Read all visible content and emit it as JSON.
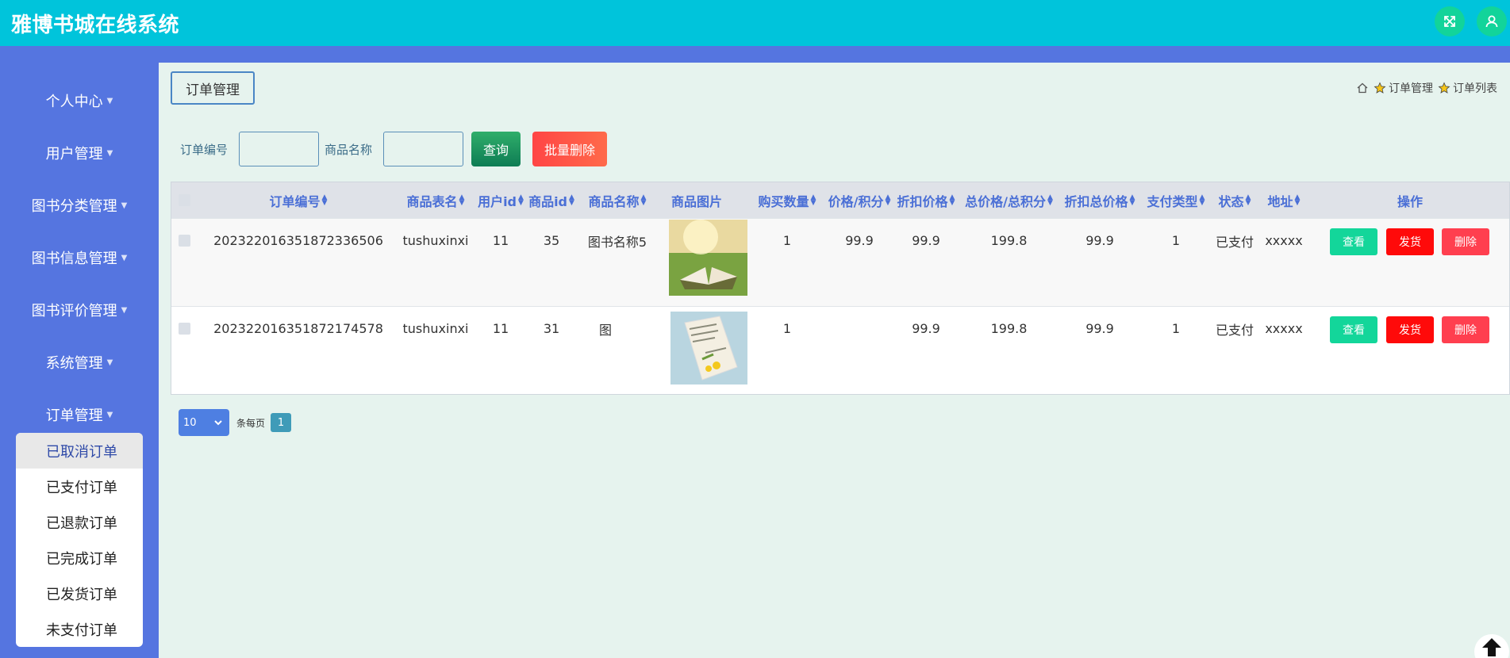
{
  "app": {
    "title": "雅博书城在线系统"
  },
  "sidebar": {
    "items": [
      {
        "label": "个人中心"
      },
      {
        "label": "用户管理"
      },
      {
        "label": "图书分类管理"
      },
      {
        "label": "图书信息管理"
      },
      {
        "label": "图书评价管理"
      },
      {
        "label": "系统管理"
      },
      {
        "label": "订单管理"
      }
    ],
    "submenu": [
      {
        "label": "已取消订单"
      },
      {
        "label": "已支付订单"
      },
      {
        "label": "已退款订单"
      },
      {
        "label": "已完成订单"
      },
      {
        "label": "已发货订单"
      },
      {
        "label": "未支付订单"
      }
    ]
  },
  "page_tab": {
    "label": "订单管理"
  },
  "breadcrumb": {
    "level1": "订单管理",
    "level2": "订单列表"
  },
  "search": {
    "order_no_label": "订单编号",
    "order_no_value": "",
    "goods_name_label": "商品名称",
    "goods_name_value": "",
    "query_label": "查询",
    "batch_delete_label": "批量删除"
  },
  "table": {
    "headers": [
      "订单编号",
      "商品表名",
      "用户id",
      "商品id",
      "商品名称",
      "商品图片",
      "购买数量",
      "价格/积分",
      "折扣价格",
      "总价格/总积分",
      "折扣总价格",
      "支付类型",
      "状态",
      "地址",
      "操作"
    ],
    "rows": [
      {
        "order_no": "20232201635187233650​6",
        "table_name": "tushuxinxi",
        "user_id": "11",
        "goods_id": "35",
        "goods_name": "图书名称5",
        "quantity": "1",
        "price": "99.9",
        "discount_price": "99.9",
        "total": "199.8",
        "discount_total": "99.9",
        "pay_type": "1",
        "status": "已支付",
        "address": "xxxxx"
      },
      {
        "order_no": "202322016351872174578",
        "table_name": "tushuxinxi",
        "user_id": "11",
        "goods_id": "31",
        "goods_name": "图",
        "quantity": "1",
        "price": "",
        "discount_price": "99.9",
        "total": "199.8",
        "discount_total": "99.9",
        "pay_type": "1",
        "status": "已支付",
        "address": "xxxxx"
      }
    ],
    "actions": {
      "view": "查看",
      "ship": "发货",
      "delete": "删除"
    }
  },
  "pagination": {
    "page_size": "10",
    "per_page_label": "条每页",
    "current_page": "1"
  },
  "colors": {
    "topbar": "#00c4db",
    "sidebar": "#5575e0",
    "header_text": "#4a6fd6",
    "view": "#13d69a",
    "ship": "#ff0a0a",
    "delete": "#ff3f4f"
  }
}
